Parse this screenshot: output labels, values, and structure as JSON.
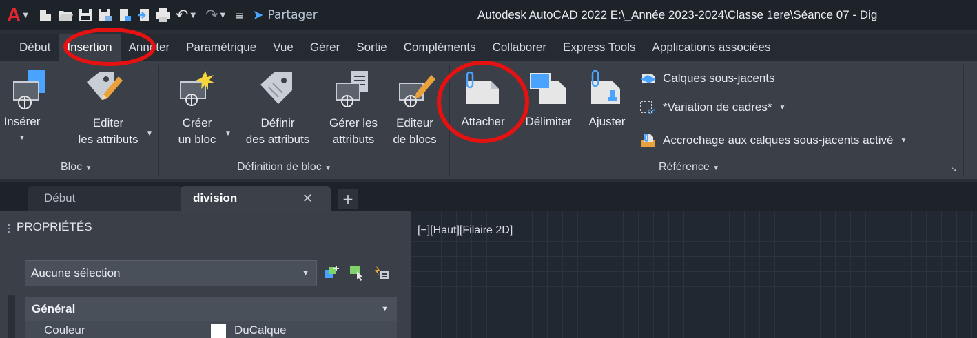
{
  "title_bar": {
    "share_label": "Partager",
    "title": "Autodesk AutoCAD 2022    E:\\_Année 2023-2024\\Classe 1ere\\Séance 07 - Dig"
  },
  "ribbon_tabs": [
    {
      "label": "Début"
    },
    {
      "label": "Insertion"
    },
    {
      "label": "Annoter"
    },
    {
      "label": "Paramétrique"
    },
    {
      "label": "Vue"
    },
    {
      "label": "Gérer"
    },
    {
      "label": "Sortie"
    },
    {
      "label": "Compléments"
    },
    {
      "label": "Collaborer"
    },
    {
      "label": "Express Tools"
    },
    {
      "label": "Applications associées"
    }
  ],
  "ribbon": {
    "bloc": {
      "inserer": "Insérer",
      "editer_l1": "Editer",
      "editer_l2": "les attributs",
      "panel_label": "Bloc"
    },
    "definition": {
      "creer_l1": "Créer",
      "creer_l2": "un bloc",
      "definir_l1": "Définir",
      "definir_l2": "des attributs",
      "gerer_l1": "Gérer les",
      "gerer_l2": "attributs",
      "editeur_l1": "Editeur",
      "editeur_l2": "de blocs",
      "panel_label": "Définition de bloc"
    },
    "reference": {
      "attacher": "Attacher",
      "delimiter": "Délimiter",
      "ajuster": "Ajuster",
      "calques": "Calques sous-jacents",
      "variation": "*Variation de cadres*",
      "accrochage": "Accrochage aux calques sous-jacents activé",
      "panel_label": "Référence"
    }
  },
  "file_tabs": {
    "start": "Début",
    "active": "division"
  },
  "properties": {
    "title": "PROPRIÉTÉS",
    "selection": "Aucune sélection",
    "section": "Général",
    "rows": [
      {
        "key": "Couleur",
        "value": "DuCalque"
      }
    ]
  },
  "viewport": {
    "label": "[−][Haut][Filaire 2D]"
  },
  "colors": {
    "accent_red": "#e51212",
    "autocad_logo": "#e3262e",
    "share_blue": "#4aa3ff"
  }
}
